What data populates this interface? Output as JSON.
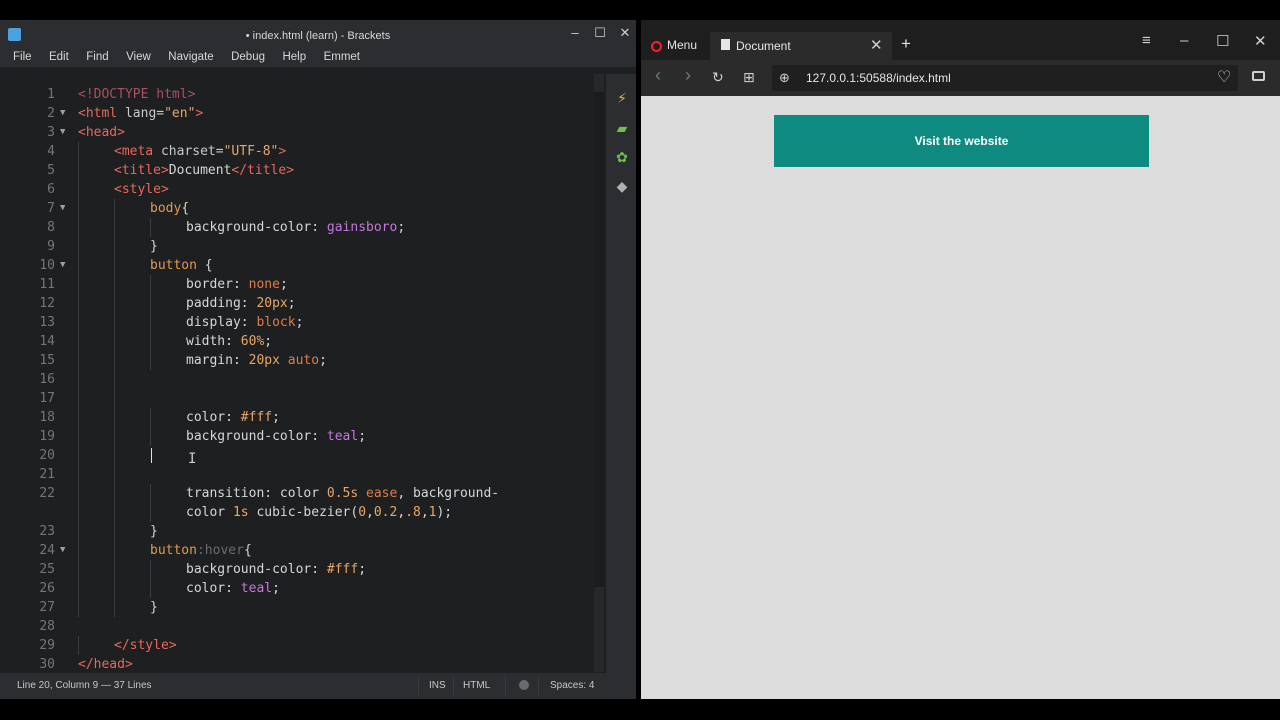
{
  "editor": {
    "title": "• index.html (learn) - Brackets",
    "menu": [
      "File",
      "Edit",
      "Find",
      "View",
      "Navigate",
      "Debug",
      "Help",
      "Emmet"
    ],
    "window_controls": {
      "minimize": "–",
      "maximize": "☐",
      "close": "✕"
    },
    "side_icons": [
      "live-preview-icon",
      "extension-manager-icon",
      "extensions-icon",
      "git-icon"
    ],
    "status": {
      "position": "Line 20, Column 9 — 37 Lines",
      "mode": "INS",
      "language": "HTML",
      "spaces": "Spaces: 4"
    },
    "lines": [
      {
        "n": "1",
        "fold": "",
        "indent": 0,
        "tokens": [
          [
            "doc",
            "<!DOCTYPE html>"
          ]
        ]
      },
      {
        "n": "2",
        "fold": "▼",
        "indent": 0,
        "tokens": [
          [
            "tag",
            "<html"
          ],
          [
            "attr",
            " lang="
          ],
          [
            "str",
            "\"en\""
          ],
          [
            "tag",
            ">"
          ]
        ]
      },
      {
        "n": "3",
        "fold": "▼",
        "indent": 0,
        "tokens": [
          [
            "tag",
            "<head>"
          ]
        ]
      },
      {
        "n": "4",
        "fold": "",
        "indent": 1,
        "tokens": [
          [
            "tag",
            "<meta"
          ],
          [
            "attr",
            " charset="
          ],
          [
            "str",
            "\"UTF-8\""
          ],
          [
            "tag",
            ">"
          ]
        ]
      },
      {
        "n": "5",
        "fold": "",
        "indent": 1,
        "tokens": [
          [
            "tag",
            "<title>"
          ],
          [
            "text",
            "Document"
          ],
          [
            "tag",
            "</title>"
          ]
        ]
      },
      {
        "n": "6",
        "fold": "",
        "indent": 1,
        "tokens": [
          [
            "tag",
            "<style>"
          ]
        ]
      },
      {
        "n": "7",
        "fold": "▼",
        "indent": 2,
        "tokens": [
          [
            "sel",
            "body"
          ],
          [
            "pun",
            "{"
          ]
        ]
      },
      {
        "n": "8",
        "fold": "",
        "indent": 3,
        "tokens": [
          [
            "prop",
            "background-color: "
          ],
          [
            "kw",
            "gainsboro"
          ],
          [
            "pun",
            ";"
          ]
        ]
      },
      {
        "n": "9",
        "fold": "",
        "indent": 2,
        "tokens": [
          [
            "pun",
            "}"
          ]
        ]
      },
      {
        "n": "10",
        "fold": "▼",
        "indent": 2,
        "tokens": [
          [
            "sel",
            "button"
          ],
          [
            "pun",
            " {"
          ]
        ]
      },
      {
        "n": "11",
        "fold": "",
        "indent": 3,
        "tokens": [
          [
            "prop",
            "border: "
          ],
          [
            "val",
            "none"
          ],
          [
            "pun",
            ";"
          ]
        ]
      },
      {
        "n": "12",
        "fold": "",
        "indent": 3,
        "tokens": [
          [
            "prop",
            "padding: "
          ],
          [
            "num",
            "20px"
          ],
          [
            "pun",
            ";"
          ]
        ]
      },
      {
        "n": "13",
        "fold": "",
        "indent": 3,
        "tokens": [
          [
            "prop",
            "display: "
          ],
          [
            "val",
            "block"
          ],
          [
            "pun",
            ";"
          ]
        ]
      },
      {
        "n": "14",
        "fold": "",
        "indent": 3,
        "tokens": [
          [
            "prop",
            "width: "
          ],
          [
            "num",
            "60%"
          ],
          [
            "pun",
            ";"
          ]
        ]
      },
      {
        "n": "15",
        "fold": "",
        "indent": 3,
        "tokens": [
          [
            "prop",
            "margin: "
          ],
          [
            "num",
            "20px"
          ],
          [
            "val",
            " auto"
          ],
          [
            "pun",
            ";"
          ]
        ]
      },
      {
        "n": "16",
        "fold": "",
        "indent": 0,
        "tokens": []
      },
      {
        "n": "17",
        "fold": "",
        "indent": 0,
        "tokens": []
      },
      {
        "n": "18",
        "fold": "",
        "indent": 3,
        "tokens": [
          [
            "prop",
            "color: "
          ],
          [
            "num",
            "#fff"
          ],
          [
            "pun",
            ";"
          ]
        ]
      },
      {
        "n": "19",
        "fold": "",
        "indent": 3,
        "tokens": [
          [
            "prop",
            "background-color: "
          ],
          [
            "kw",
            "teal"
          ],
          [
            "pun",
            ";"
          ]
        ]
      },
      {
        "n": "20",
        "fold": "",
        "indent": 0,
        "tokens": []
      },
      {
        "n": "21",
        "fold": "",
        "indent": 0,
        "tokens": []
      },
      {
        "n": "22",
        "fold": "",
        "indent": 3,
        "tokens": [
          [
            "prop",
            "transition: "
          ],
          [
            "prop",
            "color "
          ],
          [
            "num",
            "0.5s"
          ],
          [
            "val",
            " ease"
          ],
          [
            "pun",
            ", "
          ],
          [
            "prop",
            "background-"
          ]
        ]
      },
      {
        "n": "",
        "fold": "",
        "indent": 3,
        "tokens": [
          [
            "prop",
            "color "
          ],
          [
            "num",
            "1s"
          ],
          [
            "prop",
            " cubic-bezier("
          ],
          [
            "num",
            "0"
          ],
          [
            "pun",
            ","
          ],
          [
            "num",
            "0.2"
          ],
          [
            "pun",
            ","
          ],
          [
            "num",
            ".8"
          ],
          [
            "pun",
            ","
          ],
          [
            "num",
            "1"
          ],
          [
            "pun",
            ");"
          ]
        ]
      },
      {
        "n": "23",
        "fold": "",
        "indent": 2,
        "tokens": [
          [
            "pun",
            "}"
          ]
        ]
      },
      {
        "n": "24",
        "fold": "▼",
        "indent": 2,
        "tokens": [
          [
            "sel",
            "button"
          ],
          [
            "pseudo",
            ":hover"
          ],
          [
            "pun",
            "{"
          ]
        ]
      },
      {
        "n": "25",
        "fold": "",
        "indent": 3,
        "tokens": [
          [
            "prop",
            "background-color: "
          ],
          [
            "num",
            "#fff"
          ],
          [
            "pun",
            ";"
          ]
        ]
      },
      {
        "n": "26",
        "fold": "",
        "indent": 3,
        "tokens": [
          [
            "prop",
            "color: "
          ],
          [
            "kw",
            "teal"
          ],
          [
            "pun",
            ";"
          ]
        ]
      },
      {
        "n": "27",
        "fold": "",
        "indent": 2,
        "tokens": [
          [
            "pun",
            "}"
          ]
        ]
      },
      {
        "n": "28",
        "fold": "",
        "indent": 0,
        "tokens": []
      },
      {
        "n": "29",
        "fold": "",
        "indent": 1,
        "tokens": [
          [
            "tag",
            "</style>"
          ]
        ]
      },
      {
        "n": "30",
        "fold": "",
        "indent": 0,
        "tokens": [
          [
            "tag",
            "</head>"
          ]
        ]
      }
    ]
  },
  "browser": {
    "menu_label": "Menu",
    "tab_title": "Document",
    "tab_close": "✕",
    "new_tab": "+",
    "url": "127.0.0.1:50588/index.html",
    "page_button_label": "Visit the website",
    "window_controls": {
      "easy_setup": "≡",
      "minimize": "–",
      "maximize": "☐",
      "close": "✕"
    },
    "nav": {
      "back": "‹",
      "forward": "›",
      "reload": "↻",
      "tabs_grid": "⊞",
      "globe": "⊕",
      "heart": "♡"
    }
  },
  "colors": {
    "editor_bg": "#1d1f21",
    "page_bg": "#dcdcdc",
    "button_bg": "#0f8a80",
    "button_text": "#ffffff",
    "opera_red": "#ff1b2d"
  }
}
